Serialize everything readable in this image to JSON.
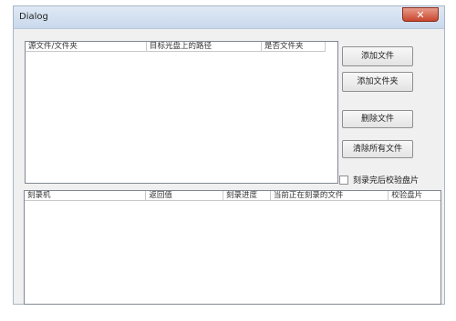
{
  "window": {
    "title": "Dialog",
    "close_label": "✕"
  },
  "source_list": {
    "columns": [
      "源文件/文件夹",
      "目标光盘上的路径",
      "是否文件夹"
    ]
  },
  "buttons": {
    "add_file": "添加文件",
    "add_folder": "添加文件夹",
    "delete_file": "删除文件",
    "clear_all": "清除所有文件"
  },
  "verify_checkbox": {
    "label": "刻录完后校验盘片",
    "checked": false
  },
  "burner_list": {
    "columns": [
      "刻录机",
      "返回值",
      "刻录进度",
      "当前正在刻录的文件",
      "校验盘片"
    ]
  }
}
